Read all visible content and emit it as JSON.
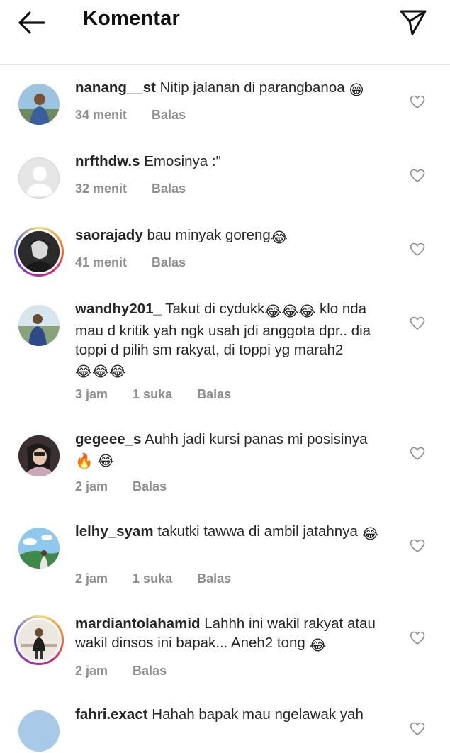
{
  "header": {
    "title": "Komentar",
    "back_icon": "arrow-left-icon",
    "send_icon": "paper-plane-icon"
  },
  "comments": [
    {
      "username": "nanang__st",
      "text": "Nitip jalanan di parangbanoa",
      "emoji": "😁",
      "time": "34 menit",
      "likes": "",
      "reply": "Balas"
    },
    {
      "username": "nrfthdw.s",
      "text": "Emosinya :\"",
      "emoji": "",
      "time": "32 menit",
      "likes": "",
      "reply": "Balas"
    },
    {
      "username": "saorajady",
      "text": "bau minyak goreng",
      "emoji": "😂",
      "time": "41 menit",
      "likes": "",
      "reply": "Balas"
    },
    {
      "username": "wandhy201_",
      "text_a": "Takut di cydukk",
      "emoji_a": "😂😂😂",
      "text_b": " klo nda mau d kritik yah ngk usah jdi anggota dpr.. dia toppi d pilih sm rakyat, di toppi yg marah2 ",
      "emoji_b": "😂😂😂",
      "time": "3 jam",
      "likes": "1 suka",
      "reply": "Balas"
    },
    {
      "username": "gegeee_s",
      "text": "Auhh jadi kursi panas mi posisinya",
      "emoji": "🔥 😂",
      "time": "2 jam",
      "likes": "",
      "reply": "Balas"
    },
    {
      "username": "lelhy_syam",
      "text": "takutki tawwa di ambil jatahnya",
      "emoji": "😂",
      "time": "2 jam",
      "likes": "1 suka",
      "reply": "Balas"
    },
    {
      "username": "mardiantolahamid",
      "text": "Lahhh ini wakil rakyat atau wakil dinsos ini bapak... Aneh2 tong",
      "emoji": "😂",
      "time": "2 jam",
      "likes": "",
      "reply": "Balas"
    },
    {
      "username": "fahri.exact",
      "text": "Hahah bapak mau ngelawak yah",
      "emoji": "",
      "time": "",
      "likes": "",
      "reply": ""
    }
  ]
}
